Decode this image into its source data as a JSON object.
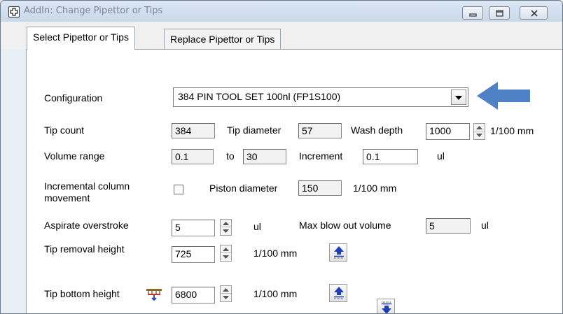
{
  "window": {
    "title": "AddIn: Change Pipettor or Tips"
  },
  "tabs": [
    {
      "label": "Select Pipettor or Tips",
      "active": true
    },
    {
      "label": "Replace Pipettor or Tips",
      "active": false
    }
  ],
  "form": {
    "configuration": {
      "label": "Configuration",
      "value": "384 PIN TOOL SET 100nl (FP1S100)"
    },
    "tip_count": {
      "label": "Tip count",
      "value": "384"
    },
    "tip_diameter": {
      "label": "Tip diameter",
      "value": "57"
    },
    "wash_depth": {
      "label": "Wash depth",
      "value": "1000",
      "unit": "1/100 mm"
    },
    "volume_range": {
      "label": "Volume range",
      "min": "0.1",
      "to": "to",
      "max": "30"
    },
    "increment": {
      "label": "Increment",
      "value": "0.1",
      "unit": "ul"
    },
    "incremental_column_movement": {
      "label_line1": "Incremental column",
      "label_line2": "movement",
      "checked": false
    },
    "piston_diameter": {
      "label": "Piston diameter",
      "value": "150",
      "unit": "1/100 mm"
    },
    "aspirate_overstroke": {
      "label": "Aspirate overstroke",
      "value": "5",
      "unit": "ul"
    },
    "max_blow_out_volume": {
      "label": "Max blow out volume",
      "value": "5",
      "unit": "ul"
    },
    "tip_removal_height": {
      "label": "Tip removal height",
      "value": "725",
      "unit": "1/100 mm"
    },
    "tip_bottom_height": {
      "label": "Tip bottom height",
      "value": "6800",
      "unit": "1/100 mm"
    }
  },
  "colors": {
    "annotation_arrow": "#4f81c7",
    "icon_button_blue": "#1f3fb8"
  },
  "icons": {
    "title": "add-in-cross-icon",
    "combo": "dropdown-arrow-icon",
    "height_up": "move-up-icon",
    "height_down": "move-down-icon",
    "tip_bottom": "tip-bottom-marker-icon"
  }
}
